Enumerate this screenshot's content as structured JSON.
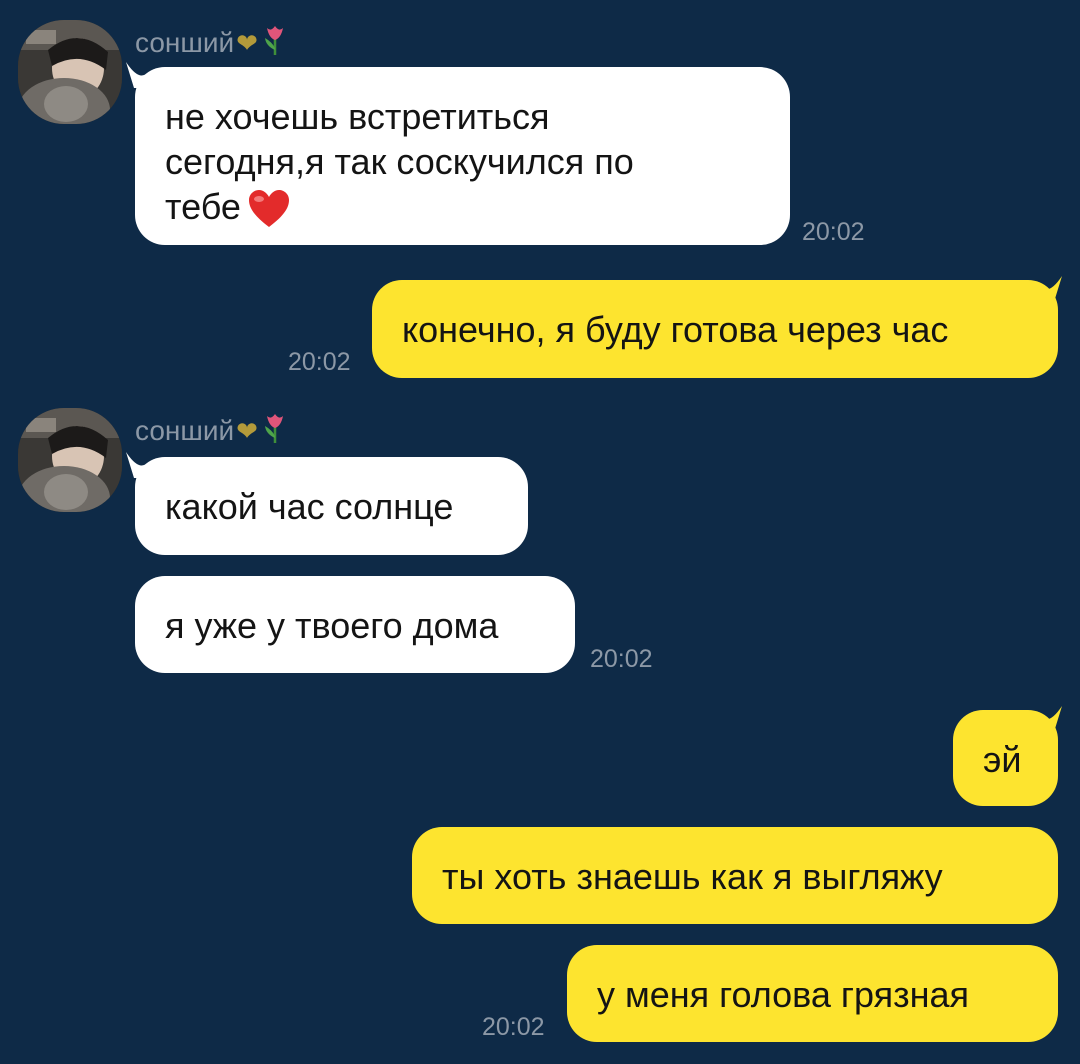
{
  "chat": {
    "contact_name": "сонший",
    "contact_emoji": "💛🌷",
    "messages": [
      {
        "id": 1,
        "direction": "incoming",
        "lines": [
          "не хочешь встретиться",
          "сегодня,я так соскучился по",
          "тебе"
        ],
        "emoji": "heart-red",
        "time": "20:02"
      },
      {
        "id": 2,
        "direction": "outgoing",
        "text": "конечно, я буду готова через час",
        "time": "20:02"
      },
      {
        "id": 3,
        "direction": "incoming",
        "text": "какой час солнце"
      },
      {
        "id": 4,
        "direction": "incoming",
        "text": "я уже у твоего дома",
        "time": "20:02"
      },
      {
        "id": 5,
        "direction": "outgoing",
        "text": "эй"
      },
      {
        "id": 6,
        "direction": "outgoing",
        "text": "ты хоть знаешь как я выгляжу"
      },
      {
        "id": 7,
        "direction": "outgoing",
        "text": "у меня голова грязная",
        "time": "20:02"
      }
    ]
  },
  "colors": {
    "background": "#0e2a47",
    "incoming_bubble": "#ffffff",
    "outgoing_bubble": "#fde42f",
    "meta_text": "#8c98a6"
  }
}
